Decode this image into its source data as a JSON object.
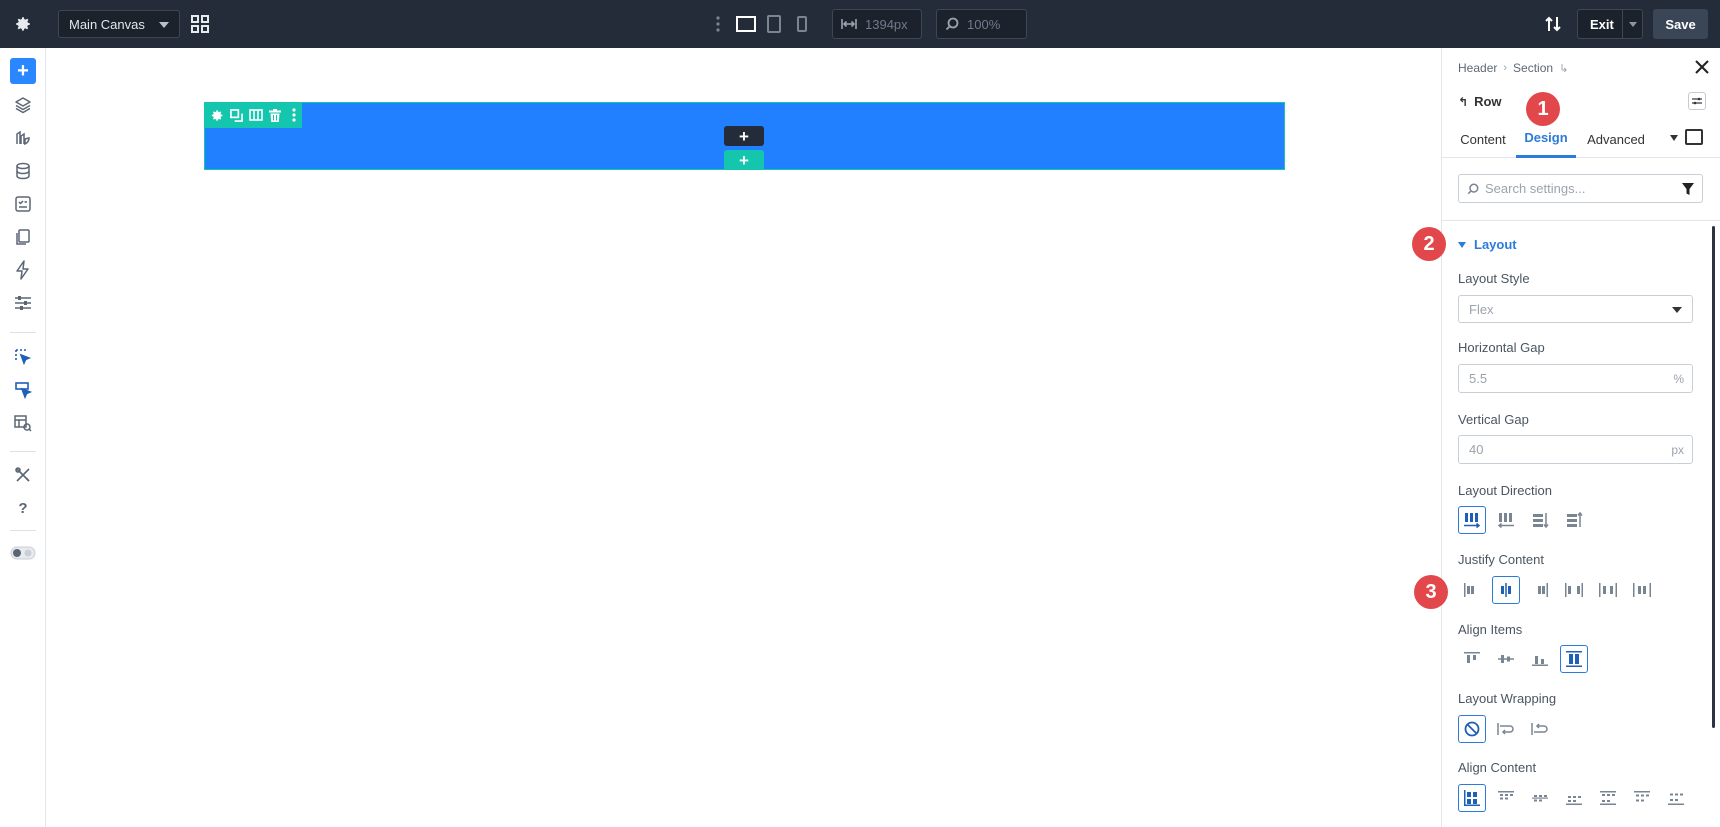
{
  "topbar": {
    "canvas_select": "Main Canvas",
    "width_value": "1394px",
    "zoom_value": "100%",
    "exit_label": "Exit",
    "save_label": "Save"
  },
  "builder": {
    "row_add_label": "+",
    "section_add_label": "+"
  },
  "panel": {
    "breadcrumb": [
      "Header",
      "Section"
    ],
    "module_title": "Row",
    "tabs": [
      {
        "label": "Content",
        "active": false
      },
      {
        "label": "Design",
        "active": true
      },
      {
        "label": "Advanced",
        "active": false
      }
    ],
    "search_placeholder": "Search settings...",
    "group_title": "Layout",
    "layout_style": {
      "label": "Layout Style",
      "value": "Flex"
    },
    "horizontal_gap": {
      "label": "Horizontal Gap",
      "value": "5.5",
      "unit": "%"
    },
    "vertical_gap": {
      "label": "Vertical Gap",
      "value": "40",
      "unit": "px"
    },
    "layout_direction": {
      "label": "Layout Direction",
      "selected_index": 0
    },
    "justify_content": {
      "label": "Justify Content",
      "selected_index": 1
    },
    "align_items": {
      "label": "Align Items",
      "selected_index": 3
    },
    "layout_wrapping": {
      "label": "Layout Wrapping",
      "selected_index": 0
    },
    "align_content": {
      "label": "Align Content",
      "selected_index": 0
    }
  },
  "badges": [
    "1",
    "2",
    "3"
  ],
  "colors": {
    "topbar": "#232c38",
    "row_blue": "#2180ff",
    "accent_teal": "#15c6ae",
    "active_blue": "#2b7bd9",
    "badge_red": "#e2474b"
  }
}
